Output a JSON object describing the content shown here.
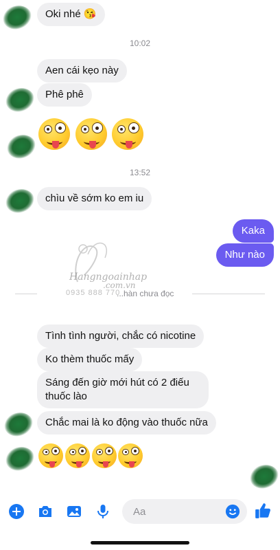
{
  "messages": {
    "m1": "Oki nhé 😘",
    "time1": "10:02",
    "m2": "Aen cái kẹo này",
    "m3": "Phê phê",
    "time2": "13:52",
    "m4": "chìu về sớm ko em iu",
    "o1": "Kaka",
    "o2": "Như nào",
    "m5": "Tình tình người, chắc có nicotine",
    "m6": "Ko thèm thuốc mấy",
    "m7": "Sáng đến giờ mới hút có 2 điếu thuốc lào",
    "m8": "Chắc mai là ko động  vào thuốc nữa"
  },
  "divider": {
    "text": "...hàn chưa đọc"
  },
  "watermark": {
    "brand": "Hangngoainhap",
    "domain": ".com.vn",
    "phone": "0935 888 770"
  },
  "composer": {
    "placeholder": "Aa"
  },
  "colors": {
    "outgoing": "#6b5bf0",
    "incoming": "#efeff1",
    "accent": "#1877f2"
  },
  "icons": [
    "plus-icon",
    "camera-icon",
    "image-icon",
    "microphone-icon",
    "emoji-icon",
    "thumbs-up-icon"
  ]
}
